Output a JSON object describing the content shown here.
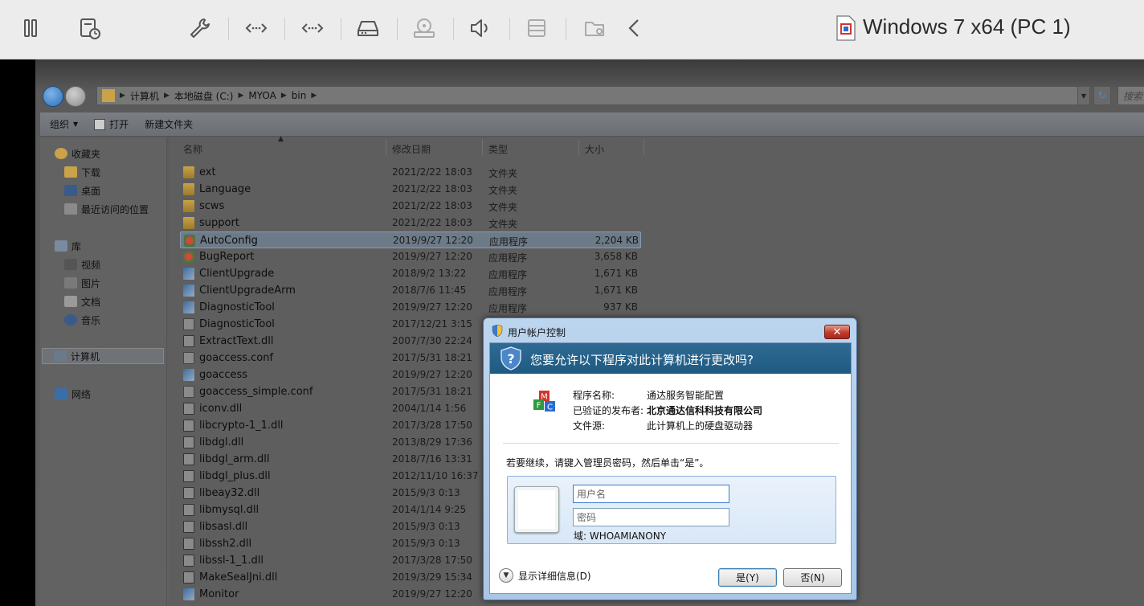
{
  "vm_toolbar": {
    "title": "Windows 7 x64 (PC 1)",
    "icons": [
      "pause-icon",
      "snapshot-icon",
      "settings-icon",
      "network-icon",
      "network-icon",
      "hard-disk-icon",
      "cd-icon",
      "volume-icon",
      "printer-icon",
      "shared-folders-icon",
      "back-chevron-icon"
    ]
  },
  "explorer": {
    "breadcrumb": [
      "计算机",
      "本地磁盘 (C:)",
      "MYOA",
      "bin"
    ],
    "search_placeholder": "搜索",
    "commands": {
      "organize": "组织",
      "open": "打开",
      "new_folder": "新建文件夹"
    },
    "nav": {
      "favorites": "收藏夹",
      "downloads": "下载",
      "desktop": "桌面",
      "recent": "最近访问的位置",
      "libraries": "库",
      "videos": "视频",
      "pictures": "图片",
      "documents": "文档",
      "music": "音乐",
      "computer": "计算机",
      "network": "网络"
    },
    "columns": {
      "name": "名称",
      "date": "修改日期",
      "type": "类型",
      "size": "大小"
    },
    "files": [
      {
        "name": "ext",
        "date": "2021/2/22 18:03",
        "type": "文件夹",
        "size": "",
        "icon": "folder"
      },
      {
        "name": "Language",
        "date": "2021/2/22 18:03",
        "type": "文件夹",
        "size": "",
        "icon": "folder"
      },
      {
        "name": "scws",
        "date": "2021/2/22 18:03",
        "type": "文件夹",
        "size": "",
        "icon": "folder"
      },
      {
        "name": "support",
        "date": "2021/2/22 18:03",
        "type": "文件夹",
        "size": "",
        "icon": "folder"
      },
      {
        "name": "AutoConfig",
        "date": "2019/9/27 12:20",
        "type": "应用程序",
        "size": "2,204 KB",
        "icon": "app"
      },
      {
        "name": "BugReport",
        "date": "2019/9/27 12:20",
        "type": "应用程序",
        "size": "3,658 KB",
        "icon": "app"
      },
      {
        "name": "ClientUpgrade",
        "date": "2018/9/2 13:22",
        "type": "应用程序",
        "size": "1,671 KB",
        "icon": "exe"
      },
      {
        "name": "ClientUpgradeArm",
        "date": "2018/7/6 11:45",
        "type": "应用程序",
        "size": "1,671 KB",
        "icon": "exe"
      },
      {
        "name": "DiagnosticTool",
        "date": "2019/9/27 12:20",
        "type": "应用程序",
        "size": "937 KB",
        "icon": "exe"
      },
      {
        "name": "DiagnosticTool",
        "date": "2017/12/21 3:15",
        "type": "",
        "size": "",
        "icon": "file"
      },
      {
        "name": "ExtractText.dll",
        "date": "2007/7/30 22:24",
        "type": "",
        "size": "",
        "icon": "dll"
      },
      {
        "name": "goaccess.conf",
        "date": "2017/5/31 18:21",
        "type": "",
        "size": "",
        "icon": "file"
      },
      {
        "name": "goaccess",
        "date": "2019/9/27 12:20",
        "type": "",
        "size": "",
        "icon": "exe"
      },
      {
        "name": "goaccess_simple.conf",
        "date": "2017/5/31 18:21",
        "type": "",
        "size": "",
        "icon": "file"
      },
      {
        "name": "iconv.dll",
        "date": "2004/1/14 1:56",
        "type": "",
        "size": "",
        "icon": "dll"
      },
      {
        "name": "libcrypto-1_1.dll",
        "date": "2017/3/28 17:50",
        "type": "",
        "size": "",
        "icon": "dll"
      },
      {
        "name": "libdgl.dll",
        "date": "2013/8/29 17:36",
        "type": "",
        "size": "",
        "icon": "dll"
      },
      {
        "name": "libdgl_arm.dll",
        "date": "2018/7/16 13:31",
        "type": "",
        "size": "",
        "icon": "dll"
      },
      {
        "name": "libdgl_plus.dll",
        "date": "2012/11/10 16:37",
        "type": "",
        "size": "",
        "icon": "dll"
      },
      {
        "name": "libeay32.dll",
        "date": "2015/9/3 0:13",
        "type": "",
        "size": "",
        "icon": "dll"
      },
      {
        "name": "libmysql.dll",
        "date": "2014/1/14 9:25",
        "type": "",
        "size": "",
        "icon": "dll"
      },
      {
        "name": "libsasl.dll",
        "date": "2015/9/3 0:13",
        "type": "",
        "size": "",
        "icon": "dll"
      },
      {
        "name": "libssh2.dll",
        "date": "2015/9/3 0:13",
        "type": "",
        "size": "",
        "icon": "dll"
      },
      {
        "name": "libssl-1_1.dll",
        "date": "2017/3/28 17:50",
        "type": "",
        "size": "",
        "icon": "dll"
      },
      {
        "name": "MakeSealJni.dll",
        "date": "2019/3/29 15:34",
        "type": "",
        "size": "",
        "icon": "dll"
      },
      {
        "name": "Monitor",
        "date": "2019/9/27 12:20",
        "type": "",
        "size": "",
        "icon": "exe"
      }
    ],
    "selected_file": "AutoConfig"
  },
  "uac": {
    "title": "用户帐户控制",
    "question": "您要允许以下程序对此计算机进行更改吗?",
    "program_name_label": "程序名称:",
    "program_name": "通达服务智能配置",
    "publisher_label": "已验证的发布者:",
    "publisher": "北京通达信科科技有限公司",
    "source_label": "文件源:",
    "source": "此计算机上的硬盘驱动器",
    "prompt": "若要继续，请键入管理员密码，然后单击“是”。",
    "username_placeholder": "用户名",
    "password_placeholder": "密码",
    "domain": "域: WHOAMIANONY",
    "details": "显示详细信息(D)",
    "yes": "是(Y)",
    "no": "否(N)"
  },
  "colors": {
    "toolbar_bg": "#ececec",
    "uac_banner": "#1f5a82",
    "uac_frame": "#bcd5ee"
  }
}
